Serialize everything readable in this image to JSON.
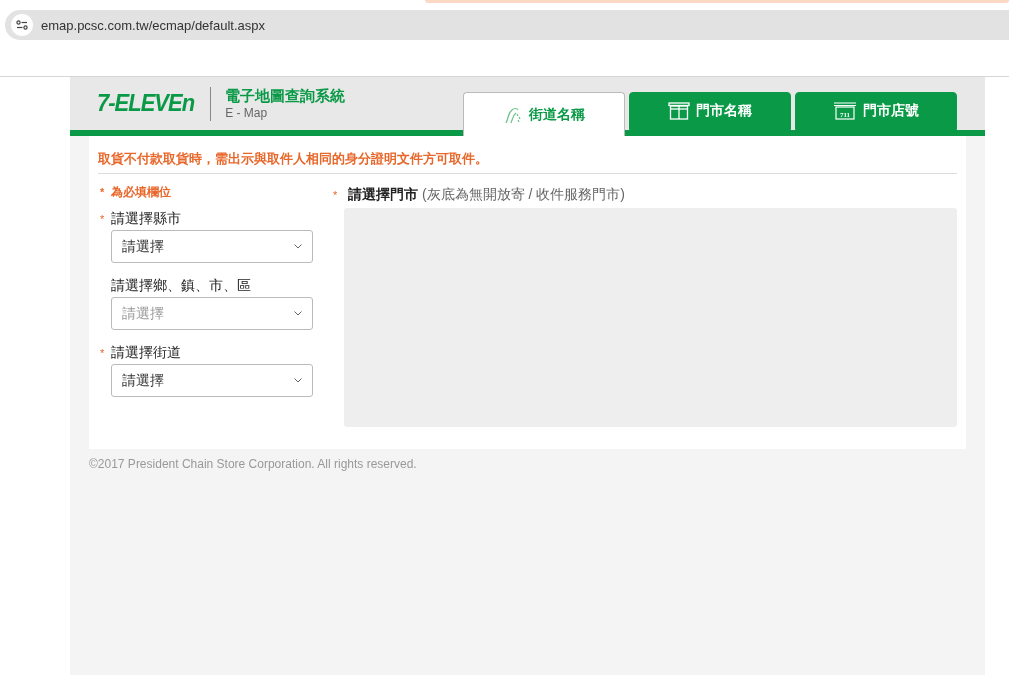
{
  "browser": {
    "url": "emap.pcsc.com.tw/ecmap/default.aspx"
  },
  "header": {
    "logo": "7-ELEVEn",
    "title": "電子地圖查詢系統",
    "subtitle": "E - Map"
  },
  "tabs": [
    {
      "label": "街道名稱",
      "kind": "street",
      "selected": true
    },
    {
      "label": "門市名稱",
      "kind": "store",
      "selected": false
    },
    {
      "label": "門市店號",
      "kind": "number",
      "selected": false,
      "icon_text": "711"
    }
  ],
  "notice": "取貨不付款取貨時，需出示與取件人相同的身分證明文件方可取件。",
  "required_mark": "*",
  "required_note": "為必填欄位",
  "fields": [
    {
      "label": "請選擇縣市",
      "required": true,
      "value": "請選擇",
      "disabled": false
    },
    {
      "label": "請選擇鄉、鎮、市、區",
      "required": false,
      "value": "請選擇",
      "disabled": true
    },
    {
      "label": "請選擇街道",
      "required": true,
      "value": "請選擇",
      "disabled": false
    }
  ],
  "store_picker": {
    "label": "請選擇門市",
    "hint": "(灰底為無開放寄 / 收件服務門市)",
    "required": true
  },
  "footer": "©2017 President Chain Store Corporation. All rights reserved."
}
